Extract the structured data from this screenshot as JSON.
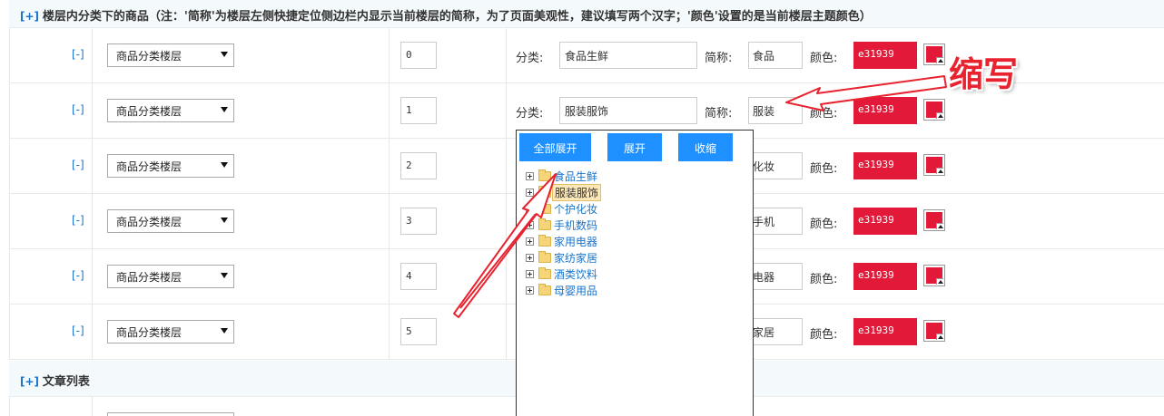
{
  "section1": {
    "toggle": "[+]",
    "title": "楼层内分类下的商品（注：'简称'为楼层左侧快捷定位侧边栏内显示当前楼层的简称，为了页面美观性，建议填写两个汉字；'颜色'设置的是当前楼层主题颜色）"
  },
  "labels": {
    "category": "分类:",
    "abbr": "简称:",
    "color": "颜色:"
  },
  "rows": [
    {
      "minus": "[-]",
      "type": "商品分类楼层",
      "sort": "0",
      "category": "食品生鲜",
      "abbr": "食品",
      "color": "e31939"
    },
    {
      "minus": "[-]",
      "type": "商品分类楼层",
      "sort": "1",
      "category": "服装服饰",
      "abbr": "服装",
      "color": "e31939"
    },
    {
      "minus": "[-]",
      "type": "商品分类楼层",
      "sort": "2",
      "abbr": "化妆",
      "color": "e31939"
    },
    {
      "minus": "[-]",
      "type": "商品分类楼层",
      "sort": "3",
      "abbr": "手机",
      "color": "e31939"
    },
    {
      "minus": "[-]",
      "type": "商品分类楼层",
      "sort": "4",
      "abbr": "电器",
      "color": "e31939"
    },
    {
      "minus": "[-]",
      "type": "商品分类楼层",
      "sort": "5",
      "abbr": "家居",
      "color": "e31939"
    }
  ],
  "tree": {
    "expand_all": "全部展开",
    "expand": "展开",
    "collapse": "收缩",
    "items": [
      "食品生鲜",
      "服装服饰",
      "个护化妆",
      "手机数码",
      "家用电器",
      "家纺家居",
      "酒类饮料",
      "母婴用品"
    ],
    "selected": "服装服饰"
  },
  "section2": {
    "toggle": "[+]",
    "title": "文章列表"
  },
  "annotation": {
    "text": "缩写",
    "color": "#e8232f"
  },
  "colors": {
    "floor_color": "#e31939",
    "link": "#1a73c9",
    "button": "#1e90ff"
  }
}
